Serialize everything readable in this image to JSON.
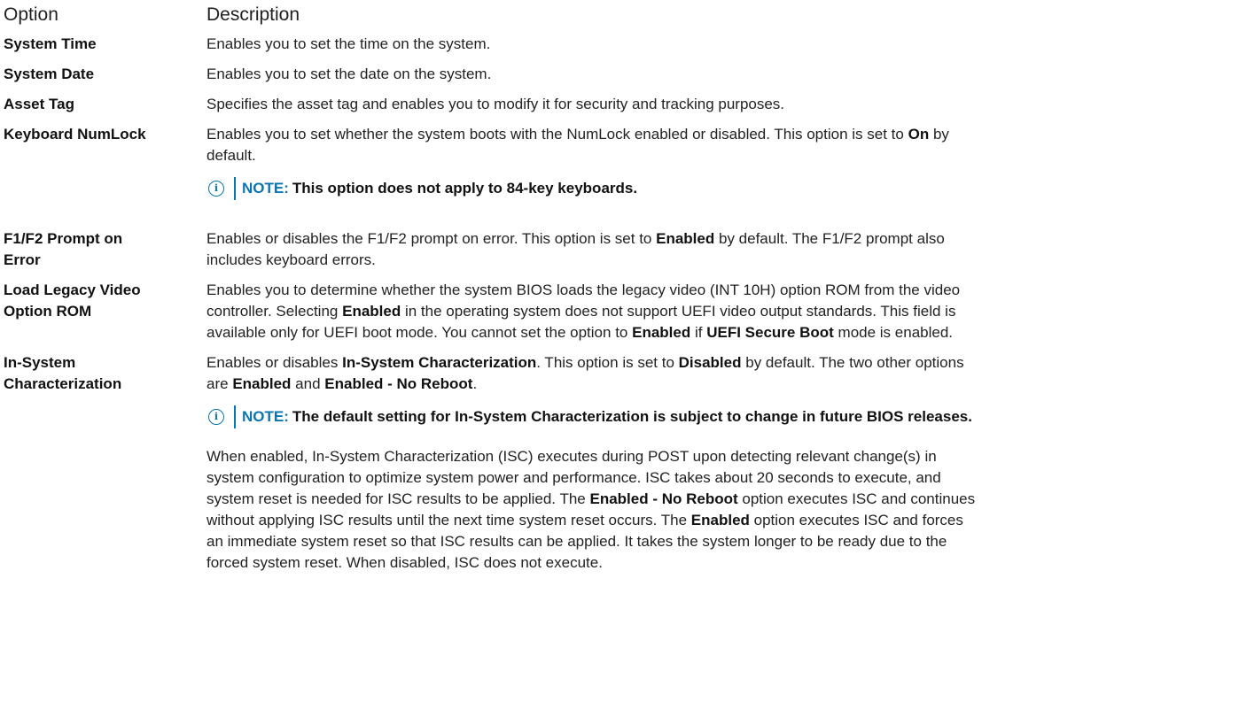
{
  "header": {
    "option": "Option",
    "description": "Description"
  },
  "rows": [
    {
      "option": "System Time",
      "description": "Enables you to set the time on the system."
    },
    {
      "option": "System Date",
      "description": "Enables you to set the date on the system."
    },
    {
      "option": "Asset Tag",
      "description": "Specifies the asset tag and enables you to modify it for security and tracking purposes."
    },
    {
      "option": "Keyboard NumLock",
      "d1": "Enables you to set whether the system boots with the NumLock enabled or disabled. This option is set to",
      "b1": "On",
      "d2": "by",
      "d3": "default.",
      "note_label": "NOTE:",
      "note_text": "This option does not apply to 84-key keyboards."
    },
    {
      "option_l1": "F1/F2 Prompt on",
      "option_l2": "Error",
      "d1": "Enables or disables the F1/F2 prompt on error. This option is set to",
      "b1": "Enabled",
      "d2": "by default. The F1/F2 prompt also",
      "d3": "includes keyboard errors."
    },
    {
      "option_l1": "Load Legacy Video",
      "option_l2": "Option ROM",
      "l1": "Enables you to determine whether the system BIOS loads the legacy video (INT 10H) option ROM from the video",
      "l2a": "controller. Selecting",
      "l2b": "Enabled",
      "l2c": "in the operating system does not support UEFI video output standards. This field is",
      "l3a": "available only for UEFI boot mode. You cannot set the option to",
      "l3b": "Enabled",
      "l3c": "if",
      "l3d": "UEFI Secure Boot",
      "l3e": "mode is enabled."
    },
    {
      "option_l1": "In-System",
      "option_l2": "Characterization",
      "l1a": "Enables or disables",
      "l1b": "In-System Characterization",
      "l1c": ". This option is set to",
      "l1d": "Disabled",
      "l1e": "by default. The two other options",
      "l2a": "are",
      "l2b": "Enabled",
      "l2c": "and",
      "l2d": "Enabled - No Reboot",
      "l2e": ".",
      "note_label": "NOTE:",
      "note_text": "The default setting for In-System Characterization is subject to change in future BIOS releases.",
      "p1": "When enabled, In-System Characterization (ISC) executes during POST upon detecting relevant change(s) in",
      "p2": "system configuration to optimize system power and performance. ISC takes about 20 seconds to execute, and",
      "p3a": "system reset is needed for ISC results to be applied. The",
      "p3b": "Enabled - No Reboot",
      "p3c": "option executes ISC and continues",
      "p4a": "without applying ISC results until the next time system reset occurs. The",
      "p4b": "Enabled",
      "p4c": "option executes ISC and forces",
      "p5": "an immediate system reset so that ISC results can be applied. It takes the system longer to be ready due to the",
      "p6": "forced system reset. When disabled, ISC does not execute."
    }
  ],
  "colors": {
    "note_accent": "#0a75b0"
  },
  "icons": {
    "note": "info-icon"
  }
}
